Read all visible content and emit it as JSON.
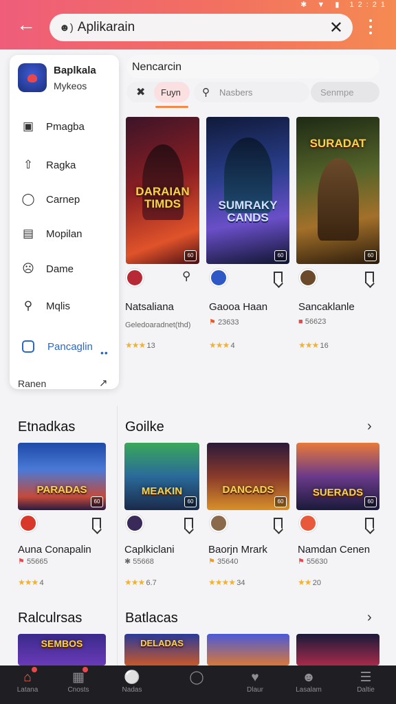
{
  "status": {
    "icons": "✱ ▼ ▮ 12:21"
  },
  "search": {
    "value": "Aplikarain",
    "icon": "user-search-icon"
  },
  "drawer": {
    "app_name": "Baplkala",
    "app_sub": "Mykeos",
    "items": [
      {
        "label": "Pmagba",
        "icon": "clipboard-icon"
      },
      {
        "label": "Ragka",
        "icon": "up-arrow-icon"
      },
      {
        "label": "Carnep",
        "icon": "compass-icon"
      },
      {
        "label": "Mopilan",
        "icon": "calendar-icon"
      },
      {
        "label": "Dame",
        "icon": "face-icon"
      },
      {
        "label": "Mqlis",
        "icon": "search-icon"
      },
      {
        "label": "Pancaglin",
        "icon": "square-icon"
      }
    ],
    "more": "••",
    "bottom_label": "Ranen"
  },
  "section_head": "Nencarcin",
  "chips": {
    "first": "Fuyn",
    "search_placeholder": "Nasbers",
    "last": "Senmpe"
  },
  "top_cards": [
    {
      "poster_title": "DARAIAN TIMDS",
      "badge": "60",
      "name": "Natsaliana",
      "sub": "Geledoaradnet(thd)",
      "rating": "13"
    },
    {
      "poster_title": "SUMRAKY CANDS",
      "badge": "60",
      "name": "Gaooa Haan",
      "sub": "23633",
      "rating": "4"
    },
    {
      "poster_title": "SURADAT",
      "badge": "60",
      "name": "Sancaklanle",
      "sub": "56623",
      "rating": "16"
    }
  ],
  "sections": [
    {
      "title": "Etnadkas"
    },
    {
      "title": "Goilke"
    },
    {
      "title": "Ralculrsas"
    },
    {
      "title": "Batlacas"
    }
  ],
  "mid_cards": [
    {
      "poster_title": "PARADAS",
      "badge": "60",
      "name": "Auna Conapalin",
      "sub": "55665",
      "rating": "4"
    },
    {
      "poster_title": "MEAKIN",
      "badge": "60",
      "name": "Caplkiclani",
      "sub": "55668",
      "rating": "6.7"
    },
    {
      "poster_title": "DANCADS",
      "badge": "60",
      "name": "Baorjn Mrark",
      "sub": "35640",
      "rating": "34"
    },
    {
      "poster_title": "SUERADS",
      "badge": "60",
      "name": "Namdan Cenen",
      "sub": "55630",
      "rating": "20"
    }
  ],
  "bottom_posters": [
    {
      "poster_title": "SEMBOS"
    },
    {
      "poster_title": "DELADAS"
    },
    {
      "poster_title": ""
    },
    {
      "poster_title": ""
    }
  ],
  "bottom_nav": [
    {
      "label": "Latana",
      "icon": "home-icon"
    },
    {
      "label": "Cnosts",
      "icon": "grid-icon"
    },
    {
      "label": "Nadas",
      "icon": "person-icon"
    },
    {
      "label": "",
      "icon": "compass-circle-icon"
    },
    {
      "label": "Dlaur",
      "icon": "heart-icon"
    },
    {
      "label": "Lasalam",
      "icon": "user-icon"
    },
    {
      "label": "Daltie",
      "icon": "menu-icon"
    }
  ],
  "colors": {
    "accent": "#ef5d7a",
    "accent2": "#f58a52",
    "link": "#2a68c8",
    "star": "#f2b231"
  }
}
